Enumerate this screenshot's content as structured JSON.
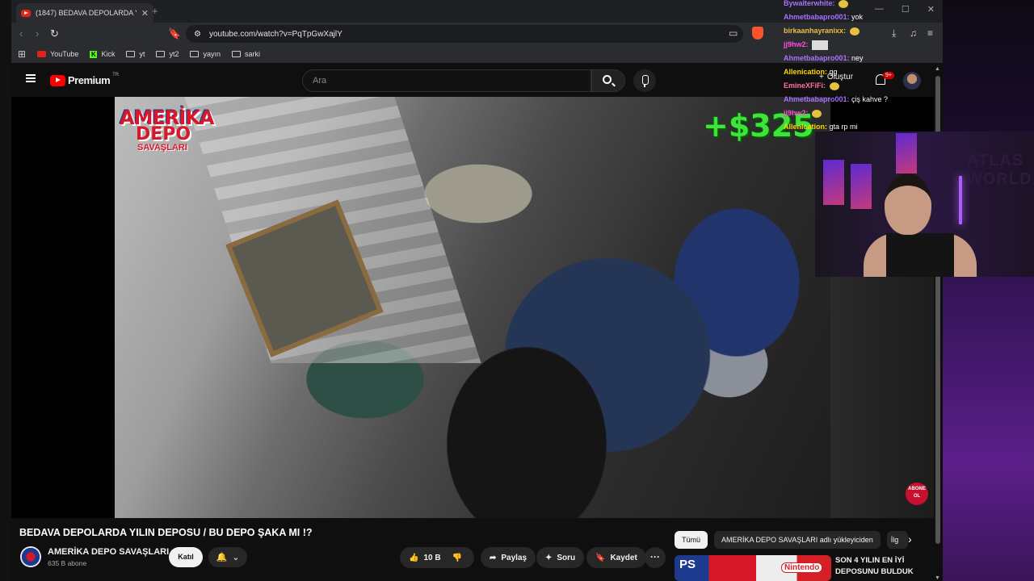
{
  "browser": {
    "tab_title": "(1847) BEDAVA DEPOLARDA YIL",
    "url": "youtube.com/watch?v=PqTpGwXajlY",
    "bookmarks": [
      {
        "label": "YouTube",
        "type": "youtube"
      },
      {
        "label": "Kick",
        "type": "kick"
      },
      {
        "label": "yt",
        "type": "folder"
      },
      {
        "label": "yt2",
        "type": "folder"
      },
      {
        "label": "yayın",
        "type": "folder"
      },
      {
        "label": "sarki",
        "type": "folder"
      }
    ]
  },
  "youtube": {
    "logo_text": "Premium",
    "logo_country": "TR",
    "search_placeholder": "Ara",
    "create_label": "Oluştur",
    "notification_badge": "9+"
  },
  "video": {
    "overlay_line1": "AMERİKA",
    "overlay_line2": "DEPO",
    "overlay_line3": "SAVAŞLARI",
    "money_text": "+$325",
    "subscribe_badge": "ABONE OL",
    "title": "BEDAVA DEPOLARDA YILIN DEPOSU / BU DEPO ŞAKA MI !?",
    "channel_name": "AMERİKA DEPO SAVAŞLARI",
    "subscribers": "635 B abone",
    "join_label": "Katıl",
    "like_count": "10 B",
    "share_label": "Paylaş",
    "ask_label": "Soru",
    "save_label": "Kaydet"
  },
  "recommendations": {
    "chips": [
      "Tümü",
      "AMERİKA DEPO SAVAŞLARI adlı yükleyiciden",
      "İlg"
    ],
    "first_title": "SON 4 YILIN EN İYİ DEPOSUNU BULDUK",
    "thumb_left": "PS",
    "thumb_right": "Nintendo"
  },
  "stream_chat": [
    {
      "user": "Bywalterwhite:",
      "message": "",
      "color": "#a970ff",
      "emote": "gold"
    },
    {
      "user": "Ahmetbabapro001:",
      "message": "yok",
      "color": "#a970ff"
    },
    {
      "user": "birkaanhayranixx:",
      "message": "",
      "color": "#e6c040",
      "emote": "gold"
    },
    {
      "user": "jj9hw2:",
      "message": "",
      "color": "#ff4fd8",
      "emote": "image"
    },
    {
      "user": "Ahmetbabapro001:",
      "message": "ney",
      "color": "#a970ff"
    },
    {
      "user": "Allenication:",
      "message": "gg",
      "color": "#ffd700"
    },
    {
      "user": "EmineXFiFi:",
      "message": "",
      "color": "#ff6fa8",
      "emote": "gold"
    },
    {
      "user": "Ahmetbabapro001:",
      "message": "çiş kahve ?",
      "color": "#a970ff"
    },
    {
      "user": "jj9hw2:",
      "message": "",
      "color": "#ff4fd8",
      "emote": "gold"
    },
    {
      "user": "Allenication:",
      "message": "gta rp mi",
      "color": "#ffd700"
    }
  ],
  "webcam": {
    "sign_text": "ATLAS\nWORLD"
  }
}
